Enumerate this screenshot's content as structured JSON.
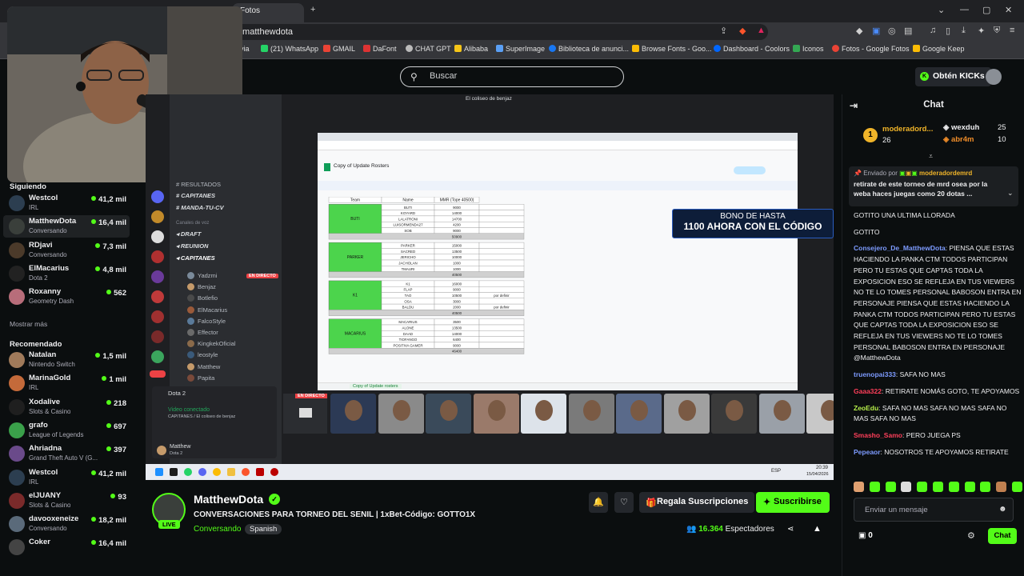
{
  "browser": {
    "tab_title": "Fotos",
    "url": "/matthewdota",
    "bookmarks": [
      "via",
      "(21) WhatsApp",
      "GMAIL",
      "DaFont",
      "CHAT GPT",
      "Alibaba",
      "SuperImage",
      "Biblioteca de anunci...",
      "Browse Fonts - Goo...",
      "Dashboard - Coolors",
      "Iconos",
      "Fotos - Google Fotos",
      "Google Keep"
    ]
  },
  "header": {
    "search_placeholder": "Buscar",
    "kicks_label": "Obtén KICKs"
  },
  "sidebar": {
    "following_title": "Siguiendo",
    "following": [
      {
        "name": "Westcol",
        "game": "IRL",
        "viewers": "41,2 mil",
        "color": "#2c3e50"
      },
      {
        "name": "MatthewDota",
        "game": "Conversando",
        "viewers": "16,4 mil",
        "color": "#3a3f3b"
      },
      {
        "name": "RDjavi",
        "game": "Conversando",
        "viewers": "7,3 mil",
        "color": "#4b3a2a"
      },
      {
        "name": "ElMacarius",
        "game": "Dota 2",
        "viewers": "4,8 mil",
        "color": "#222222"
      },
      {
        "name": "Roxanny",
        "game": "Geometry Dash",
        "viewers": "562",
        "color": "#b86d7a"
      }
    ],
    "show_more": "Mostrar más",
    "recommended_title": "Recomendado",
    "recommended": [
      {
        "name": "Natalan",
        "game": "Nintendo Switch",
        "viewers": "1,5 mil",
        "color": "#a07a5a"
      },
      {
        "name": "MarinaGold",
        "game": "IRL",
        "viewers": "1 mil",
        "color": "#c46a3a"
      },
      {
        "name": "Xodalive",
        "game": "Slots & Casino",
        "viewers": "218",
        "color": "#1f1f1f"
      },
      {
        "name": "grafo",
        "game": "League of Legends",
        "viewers": "697",
        "color": "#3aa04a"
      },
      {
        "name": "Ahriadna",
        "game": "Grand Theft Auto V (G...",
        "viewers": "397",
        "color": "#6a4a8a"
      },
      {
        "name": "Westcol",
        "game": "IRL",
        "viewers": "41,2 mil",
        "color": "#2c3e50"
      },
      {
        "name": "elJUANY",
        "game": "Slots & Casino",
        "viewers": "93",
        "color": "#7a2a2a"
      },
      {
        "name": "davooxeneize",
        "game": "Conversando",
        "viewers": "18,2 mil",
        "color": "#5a6a7a"
      },
      {
        "name": "Coker",
        "game": "",
        "viewers": "16,4 mil",
        "color": "#444444"
      }
    ]
  },
  "stream": {
    "window_title": "El coliseo de benjaz",
    "discord": {
      "channels": [
        "RESULTADOS",
        "CAPITANES",
        "MANDA-TU-CV",
        "Canales de voz",
        "DRAFT",
        "REUNION",
        "CAPITANES"
      ],
      "users": [
        "Yadzmi",
        "Benjaz",
        "Botlefio",
        "ElMacarius",
        "FalcoStyle",
        "Effector",
        "KingkekOficial",
        "leostyle",
        "Matthew",
        "Papita"
      ],
      "live_badge": "EN DIRECTO",
      "game": "Dota 2",
      "voice_status": "Video conectado",
      "voice_detail": "CAPITANES / El coliseo de benjaz",
      "user_name": "Matthew",
      "user_status": "Dota 2"
    },
    "sheet": {
      "doc_title": "Copy of Update Rosters",
      "columns": [
        "Team",
        "Name",
        "MMR (Tope 40500)"
      ],
      "teams": [
        {
          "team": "BUTI",
          "players": [
            "BUTI",
            "KOYARD",
            "LALATRONI",
            "LUISORMENDA27",
            "SOB"
          ],
          "mmr": [
            "9000",
            "14000",
            "14700",
            "4200",
            "9000"
          ],
          "total": "50900"
        },
        {
          "team": "PARKER",
          "players": [
            "PARKER",
            "SACRED",
            "JERICHO",
            "JACHOLAN",
            "TMAURI"
          ],
          "mmr": [
            "15000",
            "13500",
            "10000",
            "1000",
            "1000"
          ],
          "total": "40500"
        },
        {
          "team": "K1",
          "players": [
            "K1",
            "FLAP",
            "TAO",
            "OSA",
            "BALDU"
          ],
          "mmr": [
            "16000",
            "9000",
            "10500",
            "3000",
            "2000"
          ],
          "total": "40500",
          "notes": [
            "",
            "",
            "por definir",
            "",
            "por definir"
          ]
        },
        {
          "team": "MACARIUS",
          "players": [
            "MACARIUS",
            "ALONE",
            "DAAD",
            "TIOFANGO",
            "POSITIVA GAMER"
          ],
          "mmr": [
            "3500",
            "13500",
            "14000",
            "6400",
            "9000"
          ],
          "total": "46400"
        }
      ],
      "sheet_tab": "Copy of Update rosters"
    },
    "promo_line1": "BONO DE HASTA",
    "promo_line2": "1100 AHORA CON EL CÓDIGO",
    "live_cam_badge": "EN DIRECTO",
    "clock_time": "20:39",
    "clock_date": "15/04/2026",
    "lang": "ESP"
  },
  "channel": {
    "name": "MatthewDota",
    "live_badge": "LIVE",
    "title": "CONVERSACIONES PARA TORNEO DEL SENIL | 1xBet-Código: GOTTO1X",
    "category": "Conversando",
    "language": "Spanish",
    "gift_label": "Regala Suscripciones",
    "subscribe_label": "Suscribirse",
    "viewers": "16.364",
    "viewers_label": "Espectadores"
  },
  "chat": {
    "title": "Chat",
    "leaderboard": [
      {
        "rank": "1",
        "name": "moderadord...",
        "count": "26"
      },
      {
        "name": "wexduh",
        "count": "25"
      },
      {
        "name": "abr4m",
        "count": "10"
      }
    ],
    "pinned_prefix": "Enviado por",
    "pinned_user": "moderadordemrd",
    "pinned_text": "retirate de este torneo de mrd osea por la weba haces juegas como 20 dotas ...",
    "messages": [
      {
        "user": "",
        "color": "#efeff1",
        "text": "GOTITO      UNA ULTIMA LLORADA"
      },
      {
        "user": "",
        "color": "#efeff1",
        "text": "GOTITO"
      },
      {
        "user": "Consejero_De_MatthewDota",
        "color": "#7d9bff",
        "text": "PIENSA QUE ESTAS HACIENDO LA PANKA CTM TODOS PARTICIPAN PERO TU ESTAS QUE CAPTAS TODA LA EXPOSICION ESO SE REFLEJA EN TUS VIEWERS NO TE LO TOMES PERSONAL BABOSON ENTRA EN PERSONAJE      PIENSA QUE ESTAS HACIENDO LA PANKA CTM TODOS PARTICIPAN PERO TU ESTAS QUE CAPTAS TODA LA EXPOSICION ESO SE REFLEJA EN TUS VIEWERS NO TE LO TOMES PERSONAL BABOSON ENTRA EN PERSONAJE      @MatthewDota"
      },
      {
        "user": "truenopai333",
        "color": "#7d9bff",
        "text": "SAFA NO MAS"
      },
      {
        "user": "Gaaa322",
        "color": "#ff3f5a",
        "text": "RETIRATE NOMÁS GOTO, TE APOYAMOS"
      },
      {
        "user": "ZeoEdu",
        "color": "#b7f04a",
        "text": "SAFA NO MAS    SAFA NO MAS    SAFA NO MAS    SAFA NO MAS"
      },
      {
        "user": "Smasho_Samo",
        "color": "#ff3f5a",
        "text": "PERO JUEGA PS"
      },
      {
        "user": "Pepeaor",
        "color": "#7d9bff",
        "text": "NOSOTROS TE APOYAMOS RETIRATE"
      }
    ],
    "input_placeholder": "Enviar un mensaje",
    "kicks_count": "0",
    "send_label": "Chat"
  }
}
